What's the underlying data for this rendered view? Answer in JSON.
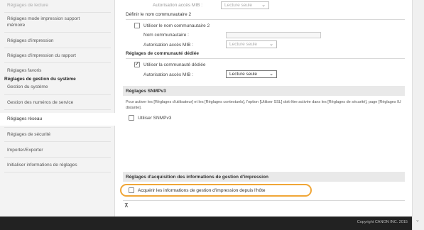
{
  "sidebar": {
    "items": [
      {
        "label": "Réglages de lecture",
        "type": "item"
      },
      {
        "label": "Réglages mode impression support",
        "type": "item"
      },
      {
        "label": "mémoire",
        "type": "item"
      },
      {
        "label": "Réglages d'impression",
        "type": "item"
      },
      {
        "label": "Réglages d'impression du rapport",
        "type": "item"
      },
      {
        "label": "Réglages favoris",
        "type": "item"
      },
      {
        "label": "Réglages de gestion du système",
        "type": "group"
      },
      {
        "label": "Gestion du système",
        "type": "item"
      },
      {
        "label": "Gestion des numéros de service",
        "type": "item"
      },
      {
        "label": "Réglages réseau",
        "type": "active"
      },
      {
        "label": "Réglages de sécurité",
        "type": "item"
      },
      {
        "label": "Importer/Exporter",
        "type": "item"
      },
      {
        "label": "Initialiser informations de réglages",
        "type": "item"
      }
    ]
  },
  "main": {
    "community1": {
      "access_label": "Autorisation accès MIB :",
      "access_value": "Lecture seule"
    },
    "community2": {
      "heading": "Définir le nom communautaire 2",
      "use_label": "Utiliser le nom communautaire 2",
      "use_checked": false,
      "name_label": "Nom communautaire :",
      "name_value": "",
      "access_label": "Autorisation accès MIB :",
      "access_value": "Lecture seule"
    },
    "dedicated": {
      "heading": "Réglages de communauté dédiée",
      "use_label": "Utiliser la communauté dédiée",
      "use_checked": true,
      "access_label": "Autorisation accès MIB :",
      "access_value": "Lecture seule"
    },
    "snmpv3": {
      "heading": "Réglages SNMPv3",
      "description": "Pour activer les [Réglages d'utilisateur] et les [Réglages contextuels], l'option [Utiliser SSL] doit être activée dans les [Réglages de sécurité], page [Réglages IU distante].",
      "use_label": "Utiliser SNMPv3",
      "use_checked": false
    },
    "printer_mgmt": {
      "heading": "Réglages d'acquisition des informations de gestion d'impression",
      "acquire_label": "Acquérir les informations de gestion d'impression depuis l'hôte",
      "acquire_checked": false
    },
    "top_icon": "top-anchor-icon"
  },
  "footer": {
    "copyright": "Copyright CANON INC. 2015"
  },
  "colors": {
    "highlight": "#f0a637",
    "footer_bg": "#222222",
    "section_bg": "#e9e9e9"
  }
}
